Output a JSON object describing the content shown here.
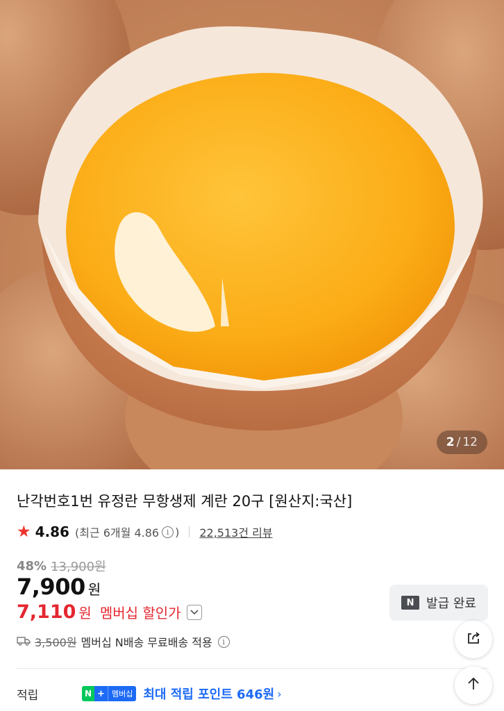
{
  "gallery": {
    "current": "2",
    "separator": "/",
    "total": "12",
    "image_icon": "egg-yolk-photo"
  },
  "product": {
    "title": "난각번호1번 유정란 무항생제 계란 20구 [원산지:국산]"
  },
  "rating": {
    "star_icon": "star-icon",
    "score": "4.86",
    "recent_label": "(최근 6개월 4.86",
    "recent_close": ")",
    "info_icon": "i",
    "review_link": "22,513건 리뷰"
  },
  "price": {
    "discount_rate": "48%",
    "original_price": "13,900원",
    "sale_price": "7,900",
    "won": "원",
    "member_price": "7,110",
    "member_won": "원",
    "member_label": "멤버십 할인가",
    "chevron": "⌄"
  },
  "coupon": {
    "icon_text": "N",
    "label": "발급 완료"
  },
  "shipping": {
    "truck_icon": "truck-icon",
    "original_fee": "3,500원",
    "text": "멤버십 N배송 무료배송 적용",
    "info_icon": "i"
  },
  "points": {
    "label": "적립",
    "badge_n": "N",
    "badge_plus": "+",
    "badge_text": "멤버십",
    "text": "최대 적립 포인트 646원",
    "arrow": "›"
  },
  "fab": {
    "share_icon": "share-icon",
    "top_icon": "arrow-up-icon"
  },
  "colors": {
    "accent_red": "#e5262f",
    "naver_green": "#03c75a",
    "naver_blue": "#1d6af5",
    "star": "#f0322d"
  }
}
